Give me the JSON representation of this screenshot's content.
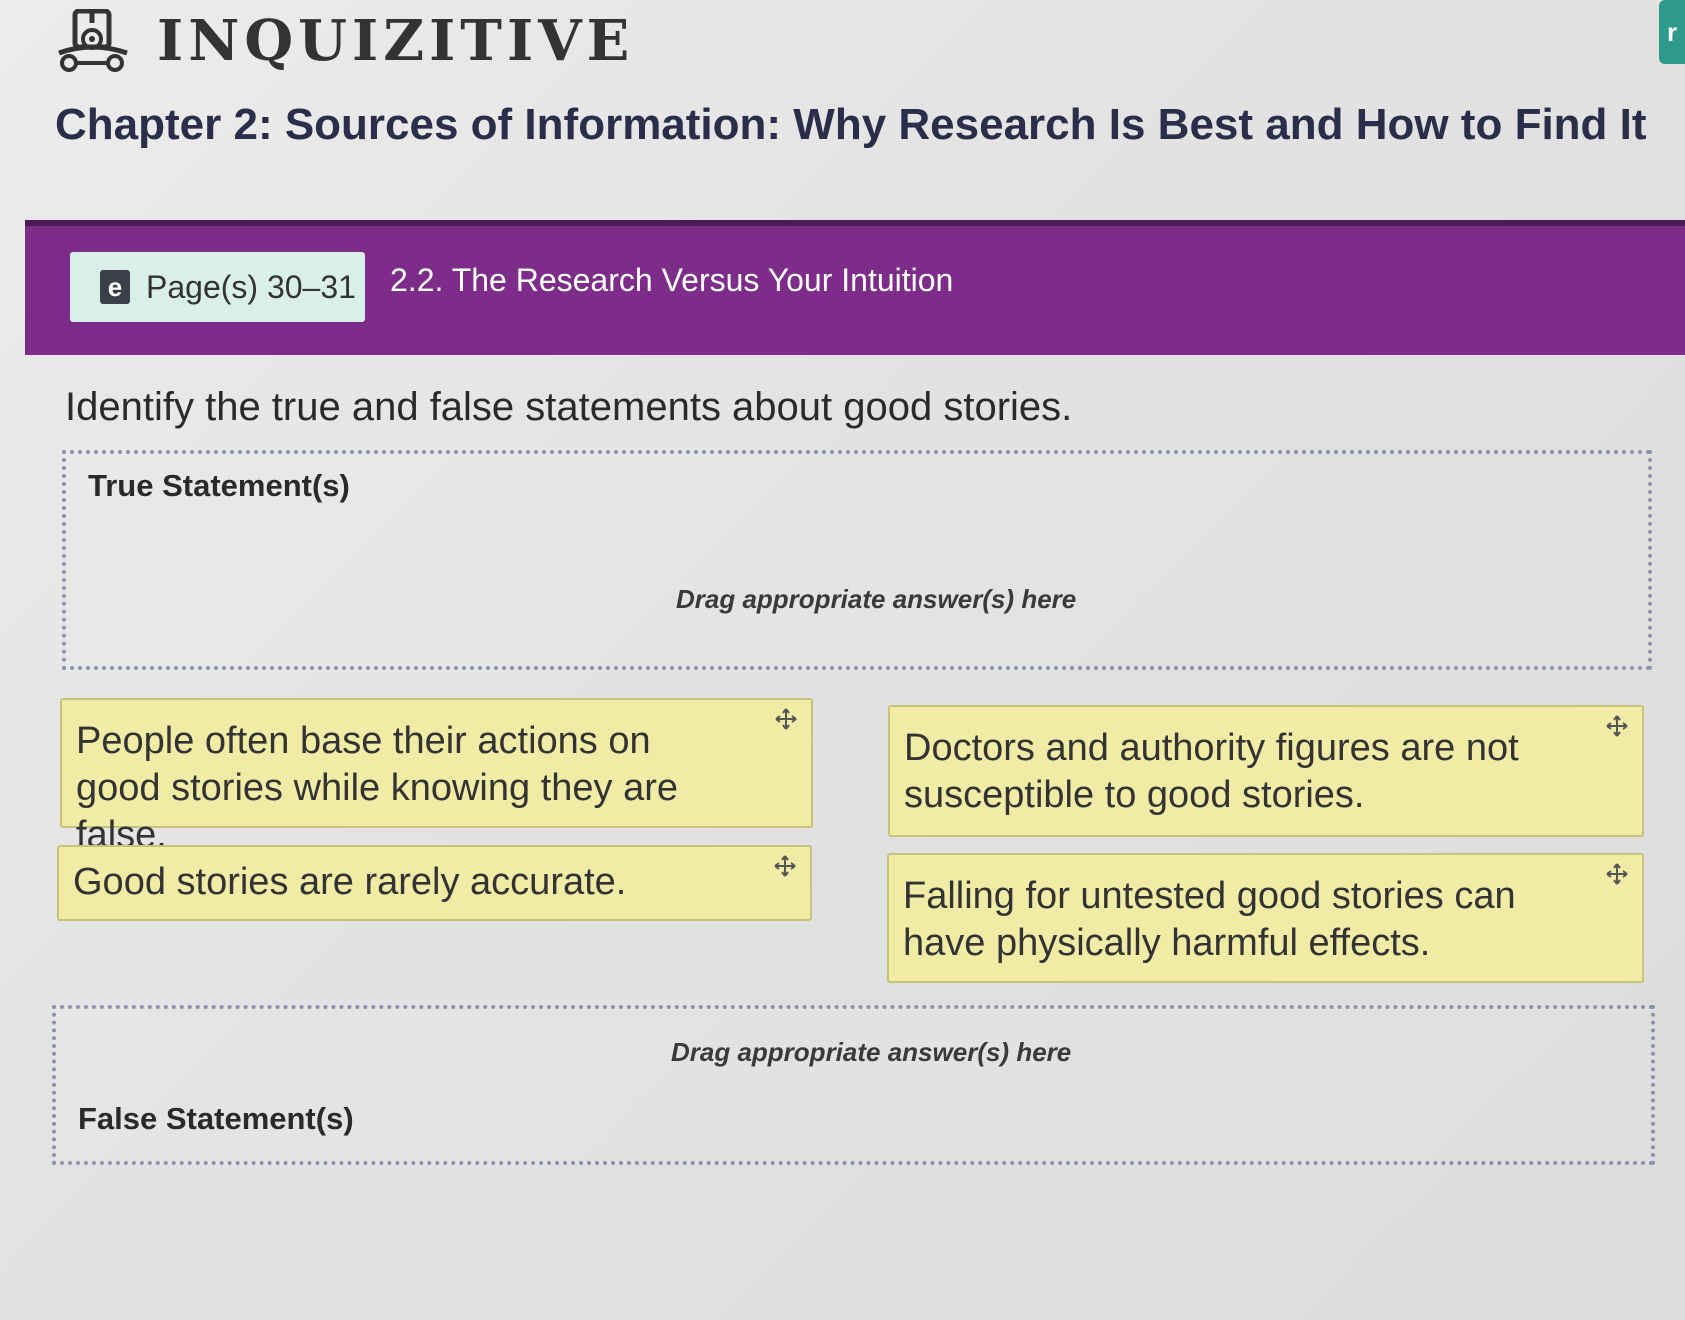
{
  "app": {
    "name": "INQUIZITIVE",
    "logo_icon": "inquizitive-logo-icon",
    "corner_tab_text": "r"
  },
  "chapter": {
    "title": "Chapter 2: Sources of Information: Why Research Is Best and How to Find It"
  },
  "section": {
    "ebook_icon_text": "e",
    "pages_label": "Page(s) 30–31",
    "title": "2.2. The Research Versus Your Intuition"
  },
  "question": {
    "prompt": "Identify the true and false statements about good stories."
  },
  "drop_zones": [
    {
      "label": "True Statement(s)",
      "hint": "Drag appropriate answer(s) here"
    },
    {
      "label": "False Statement(s)",
      "hint": "Drag appropriate answer(s) here"
    }
  ],
  "answer_cards": [
    {
      "text": "People often base their actions on good stories while knowing they are false.",
      "icon": "move-icon"
    },
    {
      "text": "Doctors and authority figures are not susceptible to good stories.",
      "icon": "move-icon"
    },
    {
      "text": "Good stories are rarely accurate.",
      "icon": "move-icon"
    },
    {
      "text": "Falling for untested good stories can have physically harmful effects.",
      "icon": "move-icon"
    }
  ],
  "colors": {
    "banner": "#7e2c8a",
    "card": "#f0eca6",
    "badge": "#d9f0ea",
    "accent_tab": "#2e9a8c"
  }
}
